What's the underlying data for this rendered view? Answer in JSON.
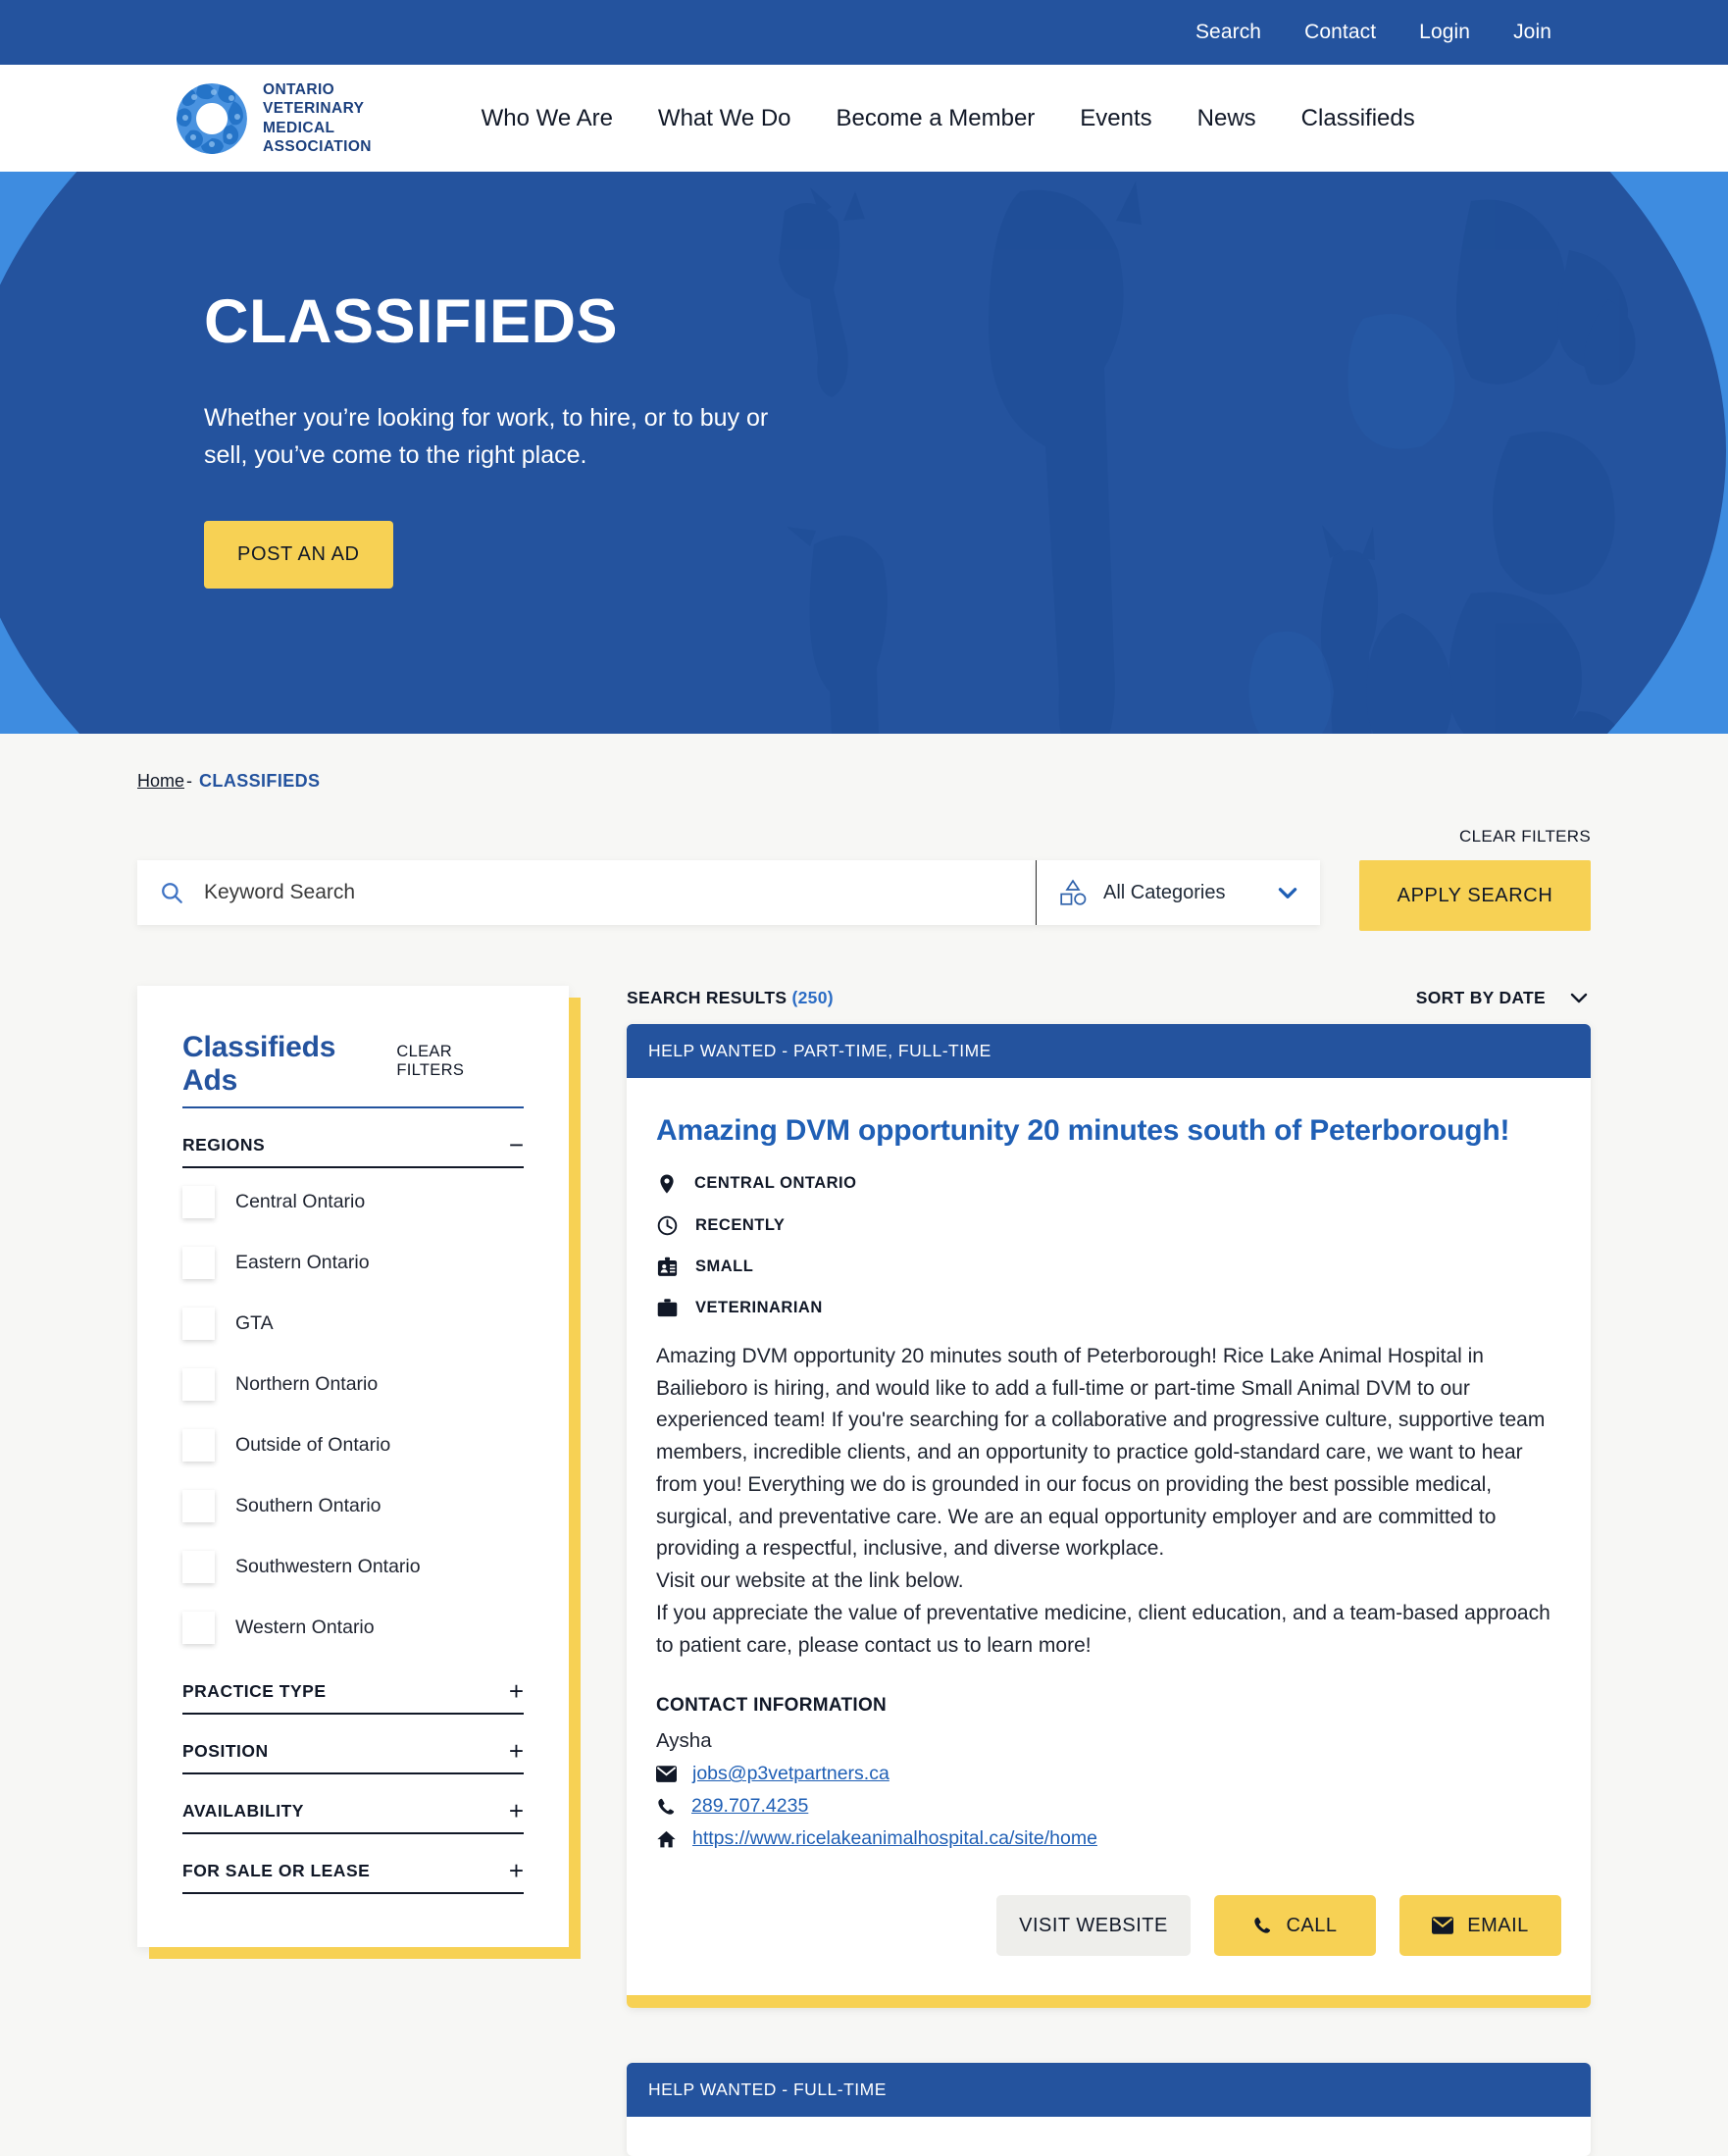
{
  "colors": {
    "brand_blue": "#24539e",
    "light_blue": "#3e8ce0",
    "accent_yellow": "#f7d154",
    "link_blue": "#1f5fb5",
    "page_bg": "#f7f7f5"
  },
  "topbar": {
    "links": [
      {
        "label": "Search",
        "name": "topbar-link-search"
      },
      {
        "label": "Contact",
        "name": "topbar-link-contact"
      },
      {
        "label": "Login",
        "name": "topbar-link-login"
      },
      {
        "label": "Join",
        "name": "topbar-link-join"
      }
    ]
  },
  "brand": {
    "logo_icon": "ovma-animal-circle-logo",
    "line1": "ONTARIO",
    "line2": "VETERINARY",
    "line3": "MEDICAL",
    "line4": "ASSOCIATION"
  },
  "mainnav": {
    "items": [
      {
        "label": "Who We Are",
        "name": "nav-who-we-are"
      },
      {
        "label": "What We Do",
        "name": "nav-what-we-do"
      },
      {
        "label": "Become a Member",
        "name": "nav-become-a-member"
      },
      {
        "label": "Events",
        "name": "nav-events"
      },
      {
        "label": "News",
        "name": "nav-news"
      },
      {
        "label": "Classifieds",
        "name": "nav-classifieds"
      }
    ]
  },
  "hero": {
    "title": "CLASSIFIEDS",
    "subtitle": "Whether you’re looking for work, to hire, or to buy or sell, you’ve come to the right place.",
    "cta_label": "POST AN AD"
  },
  "breadcrumb": {
    "home": "Home",
    "separator": "-",
    "current": "CLASSIFIEDS"
  },
  "search": {
    "clear_filters_label": "CLEAR FILTERS",
    "keyword_placeholder": "Keyword Search",
    "keyword_value": "",
    "category_selected": "All Categories",
    "apply_label": "APPLY SEARCH"
  },
  "filters": {
    "title": "Classifieds Ads",
    "clear_label": "CLEAR FILTERS",
    "groups": [
      {
        "label": "REGIONS",
        "state": "expanded",
        "toggle": "−",
        "options": [
          {
            "label": "Central Ontario",
            "checked": false
          },
          {
            "label": "Eastern Ontario",
            "checked": false
          },
          {
            "label": "GTA",
            "checked": false
          },
          {
            "label": "Northern Ontario",
            "checked": false
          },
          {
            "label": "Outside of Ontario",
            "checked": false
          },
          {
            "label": "Southern Ontario",
            "checked": false
          },
          {
            "label": "Southwestern Ontario",
            "checked": false
          },
          {
            "label": "Western Ontario",
            "checked": false
          }
        ]
      },
      {
        "label": "PRACTICE TYPE",
        "state": "collapsed",
        "toggle": "+",
        "options": []
      },
      {
        "label": "POSITION",
        "state": "collapsed",
        "toggle": "+",
        "options": []
      },
      {
        "label": "AVAILABILITY",
        "state": "collapsed",
        "toggle": "+",
        "options": []
      },
      {
        "label": "FOR SALE OR LEASE",
        "state": "collapsed",
        "toggle": "+",
        "options": []
      }
    ]
  },
  "results": {
    "label": "SEARCH RESULTS",
    "count": "(250)",
    "sort_label": "SORT BY DATE",
    "cards": [
      {
        "ribbon": "HELP WANTED - PART-TIME, FULL-TIME",
        "title": "Amazing DVM opportunity 20 minutes south of Peterborough!",
        "meta": [
          {
            "icon": "map-pin-icon",
            "text": "CENTRAL ONTARIO"
          },
          {
            "icon": "clock-icon",
            "text": "RECENTLY"
          },
          {
            "icon": "id-badge-icon",
            "text": "SMALL"
          },
          {
            "icon": "briefcase-icon",
            "text": "VETERINARIAN"
          }
        ],
        "description": "Amazing DVM opportunity 20 minutes south of Peterborough! Rice Lake Animal Hospital in Bailieboro is hiring, and would like to add a full-time or part-time Small Animal DVM to our experienced team! If you're searching for a collaborative and progressive culture, supportive team members, incredible clients, and an opportunity to practice gold-standard care, we want to hear from you! Everything we do is grounded in our focus on providing the best possible medical, surgical, and preventative care. We are an equal opportunity employer and are committed to providing a respectful, inclusive, and diverse workplace.",
        "description_line2": "Visit our website at the link below.",
        "description_line3": "If you appreciate the value of preventative medicine, client education, and a team-based approach to patient care, please contact us to learn more!",
        "contact_heading": "CONTACT INFORMATION",
        "contact_name": "Aysha",
        "contact_email": "jobs@p3vetpartners.ca",
        "contact_phone": "289.707.4235",
        "contact_website": "https://www.ricelakeanimalhospital.ca/site/home",
        "btn_website": "VISIT WEBSITE",
        "btn_call": "CALL",
        "btn_email": "EMAIL"
      },
      {
        "ribbon": "HELP WANTED - FULL-TIME"
      }
    ]
  }
}
